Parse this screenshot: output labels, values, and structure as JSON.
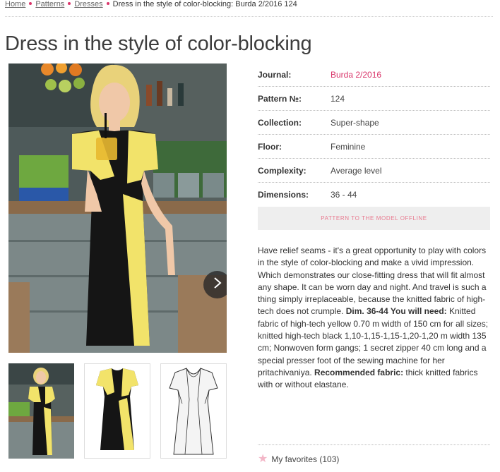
{
  "breadcrumb": {
    "items": [
      "Home",
      "Patterns",
      "Dresses"
    ],
    "current": "Dress in the style of color-blocking: Burda 2/2016 124"
  },
  "page_title": "Dress in the style of color-blocking",
  "properties": {
    "journal": {
      "label": "Journal:",
      "value": "Burda 2/2016"
    },
    "pattern_no": {
      "label": "Pattern №:",
      "value": "124"
    },
    "collection": {
      "label": "Collection:",
      "value": "Super-shape"
    },
    "floor": {
      "label": "Floor:",
      "value": "Feminine"
    },
    "complexity": {
      "label": "Complexity:",
      "value": "Average level"
    },
    "dimensions": {
      "label": "Dimensions:",
      "value": "36 - 44"
    }
  },
  "offline_button": "PATTERN TO THE MODEL OFFLINE",
  "description": {
    "part1": "Have relief seams - it's a great opportunity to play with colors in the style of color-blocking and make a vivid impression. Which demonstrates our close-fitting dress that will fit almost any shape. It can be worn day and night. And travel is such a thing simply irreplaceable, because the knitted fabric of high-tech does not crumple. ",
    "bold1": "Dim. 36-44 You will need:",
    "part2": " Knitted fabric of high-tech yellow 0.70 m width of 150 cm for all sizes; knitted high-tech black 1,10-1,15-1,15-1,20-1,20 m width 135 cm; Nonwoven form gangs; 1 secret zipper 40 cm long and a special presser foot of the sewing machine for her pritachivaniya. ",
    "bold2": "Recommended fabric:",
    "part3": " thick knitted fabrics with or without elastane."
  },
  "favorites": {
    "label": "My favorites (103)"
  },
  "colors": {
    "accent": "#d9356a",
    "offline_text": "#e87a8f",
    "dress_yellow": "#f2e36a",
    "dress_black": "#151515"
  },
  "icons": [
    "chevron-right-icon",
    "star-icon"
  ]
}
